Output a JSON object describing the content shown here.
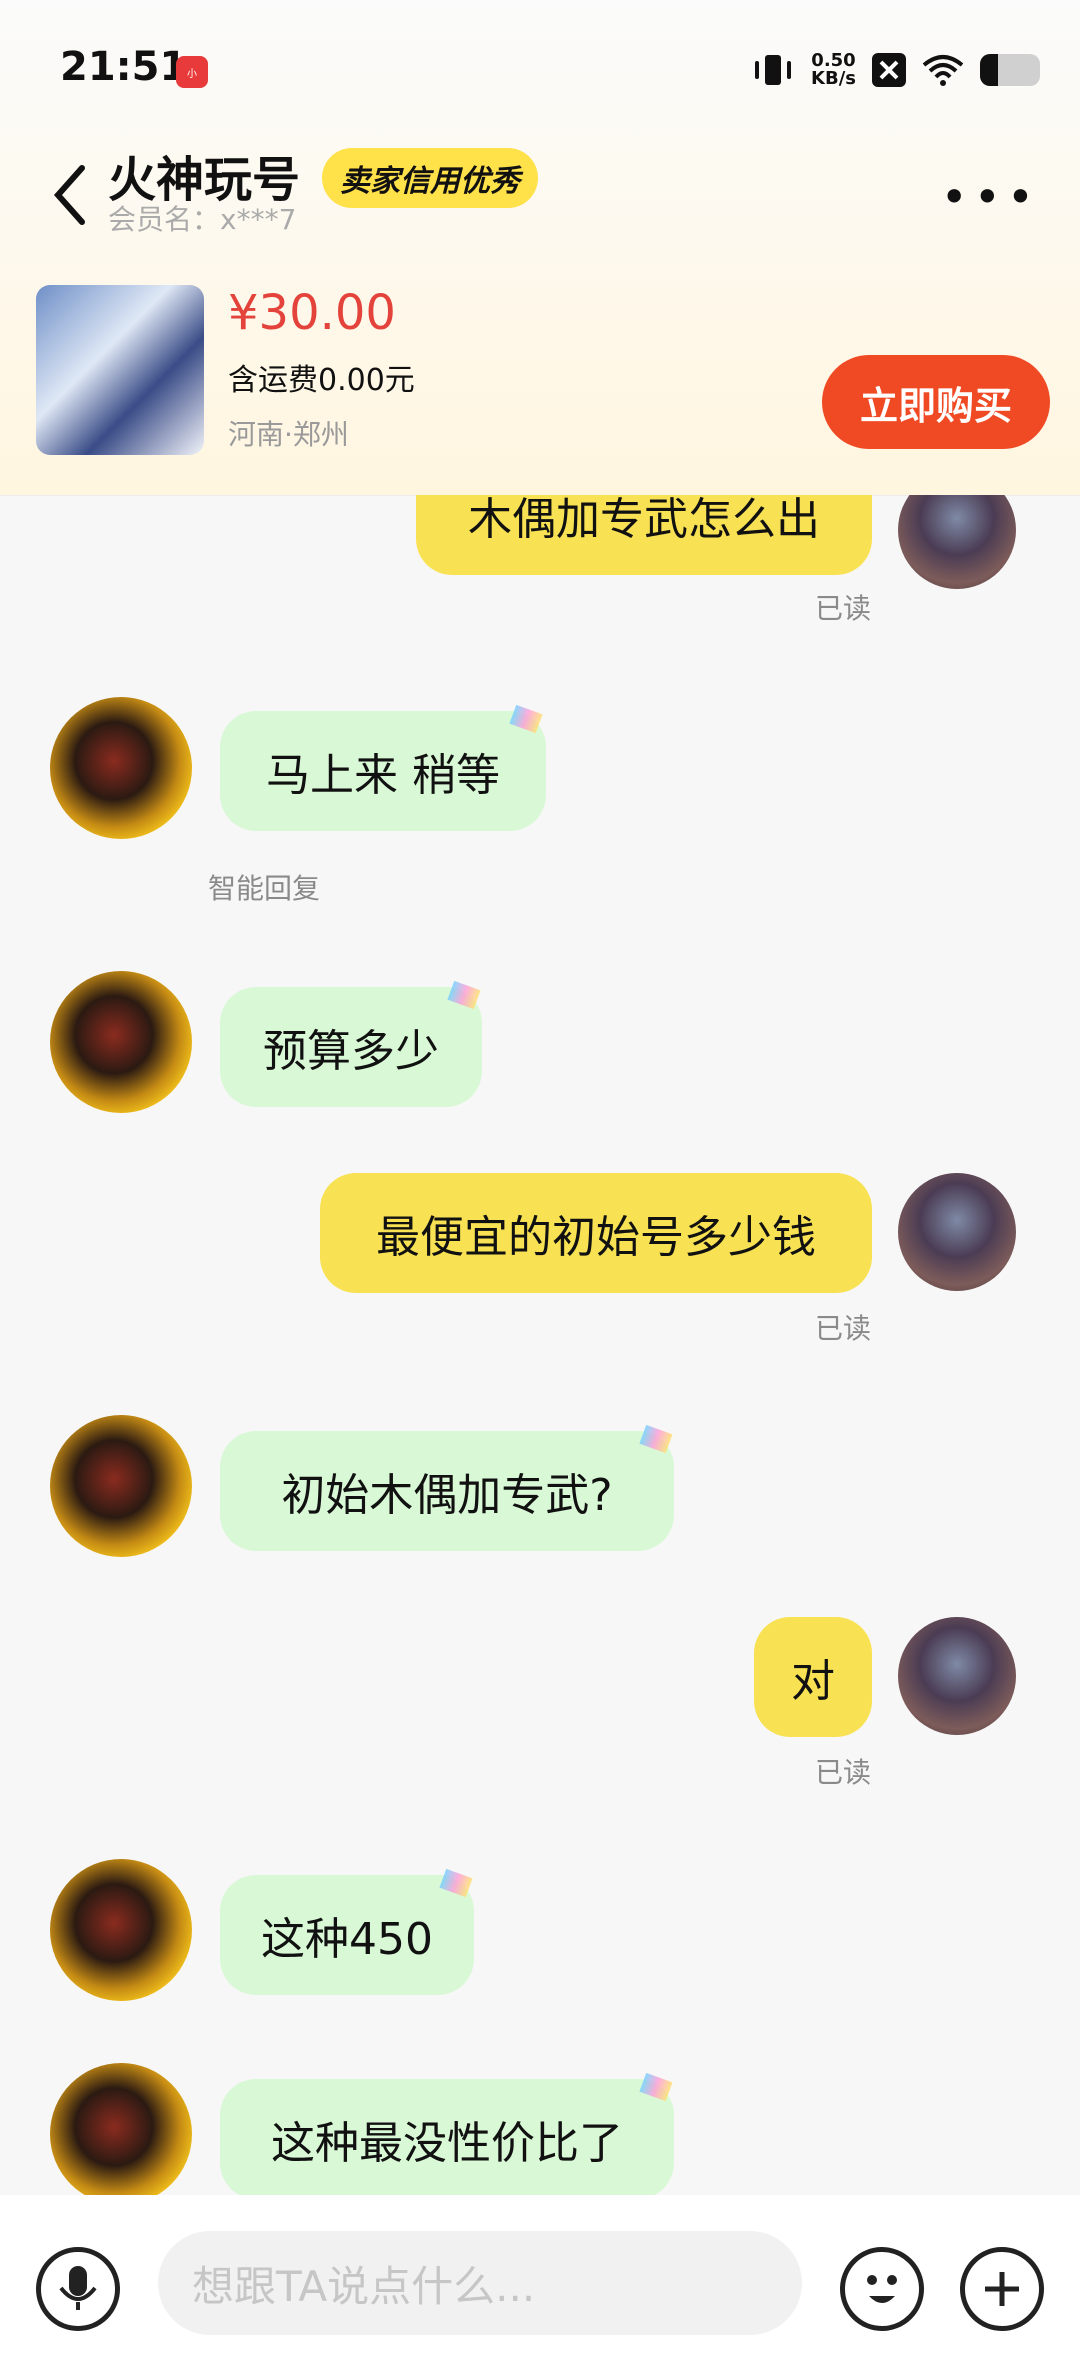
{
  "status": {
    "time": "21:51",
    "net_rate": "0.50",
    "net_unit": "KB/s",
    "battery_percent": 30
  },
  "header": {
    "shop_name": "火神玩号",
    "credit_badge": "卖家信用优秀",
    "member_name": "会员名：x***7",
    "more_label": "•••"
  },
  "product": {
    "price": "¥30.00",
    "shipping": "含运费0.00元",
    "location": "河南·郑州",
    "buy_label": "立即购买"
  },
  "messages": [
    {
      "side": "right",
      "text": "木偶加专武怎么出",
      "read": "已读"
    },
    {
      "side": "left",
      "text": "马上来 稍等",
      "note": "智能回复"
    },
    {
      "side": "left",
      "text": "预算多少"
    },
    {
      "side": "right",
      "text": "最便宜的初始号多少钱",
      "read": "已读"
    },
    {
      "side": "left",
      "text": "初始木偶加专武?"
    },
    {
      "side": "right",
      "text": "对",
      "read": "已读"
    },
    {
      "side": "left",
      "text": "这种450"
    },
    {
      "side": "left",
      "text": "这种最没性价比了"
    }
  ],
  "input": {
    "placeholder": "想跟TA说点什么..."
  },
  "icons": {
    "back": "chevron-left-icon",
    "voice": "microphone-icon",
    "emoji": "emoji-icon",
    "plus": "plus-icon"
  }
}
